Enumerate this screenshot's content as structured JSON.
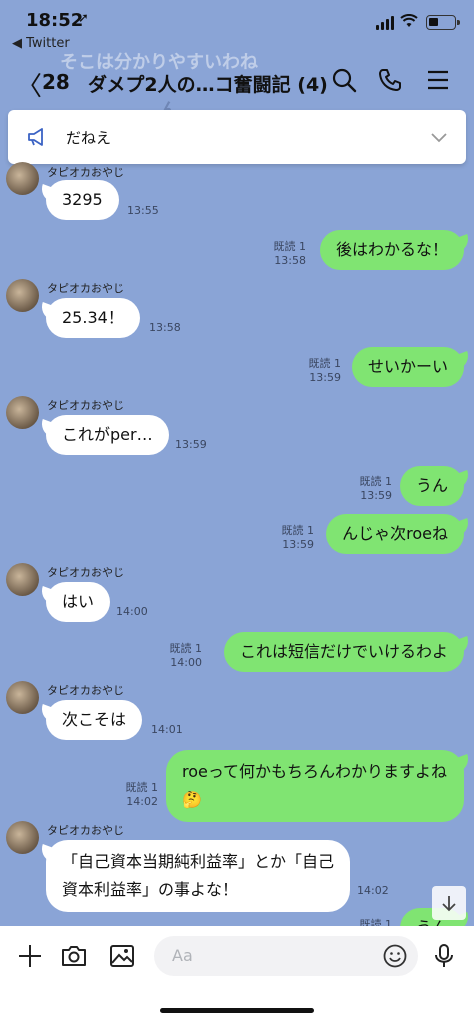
{
  "status": {
    "time": "18:52",
    "back_app": "◀ Twitter"
  },
  "header": {
    "back_count": "28",
    "title": "ダメプ2人の…コ奮闘記 (4)"
  },
  "ghost_texts": [
    "そこは分かりやすいわね",
    "ん"
  ],
  "announcement": {
    "text": "だねえ"
  },
  "messages": [
    {
      "type": "in",
      "sender": "タピオカおやじ",
      "text": "3295",
      "time": "13:55"
    },
    {
      "type": "out",
      "read": "既読 1",
      "time": "13:58",
      "text": "後はわかるな！"
    },
    {
      "type": "in",
      "sender": "タピオカおやじ",
      "text": "25.34！",
      "time": "13:58"
    },
    {
      "type": "out",
      "read": "既読 1",
      "time": "13:59",
      "text": "せいかーい"
    },
    {
      "type": "in",
      "sender": "タピオカおやじ",
      "text": "これがper…",
      "time": "13:59"
    },
    {
      "type": "out",
      "read": "既読 1",
      "time": "13:59",
      "text": "うん"
    },
    {
      "type": "out",
      "read": "既読 1",
      "time": "13:59",
      "text": "んじゃ次roeね"
    },
    {
      "type": "in",
      "sender": "タピオカおやじ",
      "text": "はい",
      "time": "14:00"
    },
    {
      "type": "out",
      "read": "既読 1",
      "time": "14:00",
      "text": "これは短信だけでいけるわよ"
    },
    {
      "type": "in",
      "sender": "タピオカおやじ",
      "text": "次こそは",
      "time": "14:01"
    },
    {
      "type": "out",
      "read": "既読 1",
      "time": "14:02",
      "text": "roeって何かもちろんわかりますよね🤔"
    },
    {
      "type": "in",
      "sender": "タピオカおやじ",
      "text": "「自己資本当期純利益率」とか「自己資本利益率」の事よな！",
      "time": "14:02"
    },
    {
      "type": "out",
      "read": "既読 1",
      "time": "",
      "text": "うん"
    }
  ],
  "input": {
    "placeholder": "Aa"
  },
  "icons": [
    "location-arrow-icon",
    "signal-icon",
    "wifi-icon",
    "battery-icon",
    "search-icon",
    "phone-icon",
    "menu-icon",
    "megaphone-icon",
    "chevron-down-icon",
    "arrow-down-icon",
    "plus-icon",
    "camera-icon",
    "image-icon",
    "emoji-icon",
    "mic-icon"
  ]
}
